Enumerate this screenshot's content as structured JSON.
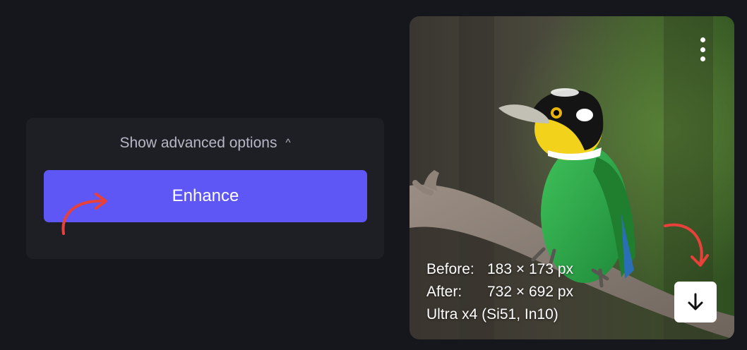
{
  "options": {
    "show_advanced_label": "Show advanced options",
    "chevron_icon": "chevron-up-icon"
  },
  "enhance_button": {
    "label": "Enhance"
  },
  "result": {
    "before_label": "Before:",
    "before_value": "183 × 173 px",
    "after_label": "After:",
    "after_value": "732 × 692 px",
    "mode": "Ultra x4 (Si51, In10)",
    "more_icon": "more-vertical-icon",
    "download_icon": "download-arrow-icon"
  },
  "colors": {
    "background": "#16161d",
    "panel": "#1e1e25",
    "accent": "#5e57f6",
    "annotation": "#e8403a"
  }
}
